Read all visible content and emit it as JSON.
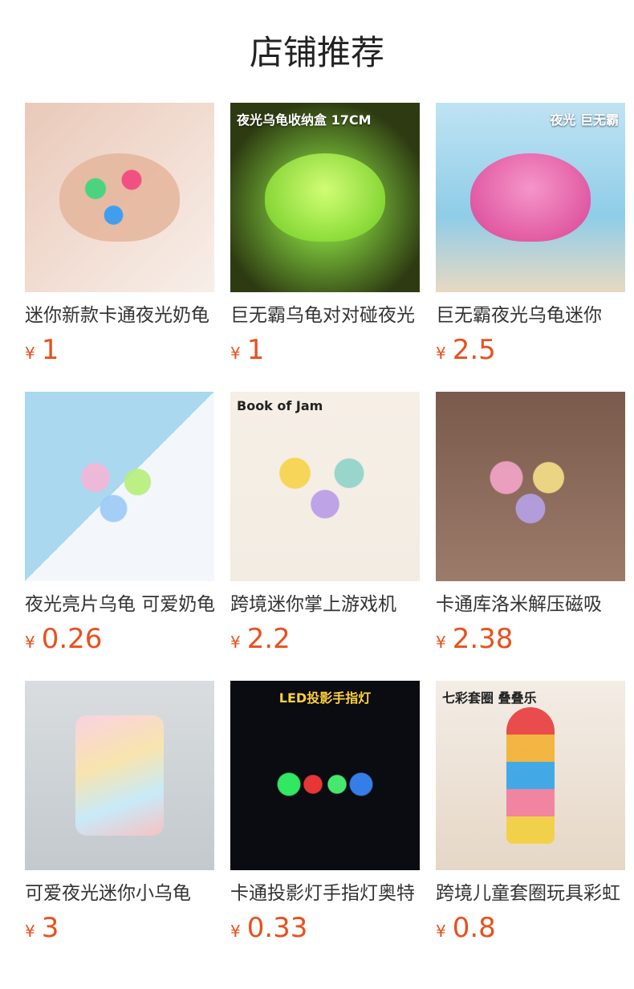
{
  "page": {
    "title": "店铺推荐"
  },
  "products": [
    {
      "title": "迷你新款卡通夜光奶龟",
      "currency": "¥",
      "price": "1",
      "image_badge": ""
    },
    {
      "title": "巨无霸乌龟对对碰夜光",
      "currency": "¥",
      "price": "1",
      "image_badge": "夜光乌龟收纳盒 17CM"
    },
    {
      "title": "巨无霸夜光乌龟迷你",
      "currency": "¥",
      "price": "2.5",
      "image_badge": "夜光 巨无霸"
    },
    {
      "title": "夜光亮片乌龟 可爱奶龟",
      "currency": "¥",
      "price": "0.26",
      "image_badge": ""
    },
    {
      "title": "跨境迷你掌上游戏机",
      "currency": "¥",
      "price": "2.2",
      "image_badge": "Book of Jam"
    },
    {
      "title": "卡通库洛米解压磁吸",
      "currency": "¥",
      "price": "2.38",
      "image_badge": ""
    },
    {
      "title": "可爱夜光迷你小乌龟",
      "currency": "¥",
      "price": "3",
      "image_badge": ""
    },
    {
      "title": "卡通投影灯手指灯奥特",
      "currency": "¥",
      "price": "0.33",
      "image_badge": "LED投影手指灯"
    },
    {
      "title": "跨境儿童套圈玩具彩虹",
      "currency": "¥",
      "price": "0.8",
      "image_badge": "七彩套圈 叠叠乐"
    }
  ]
}
